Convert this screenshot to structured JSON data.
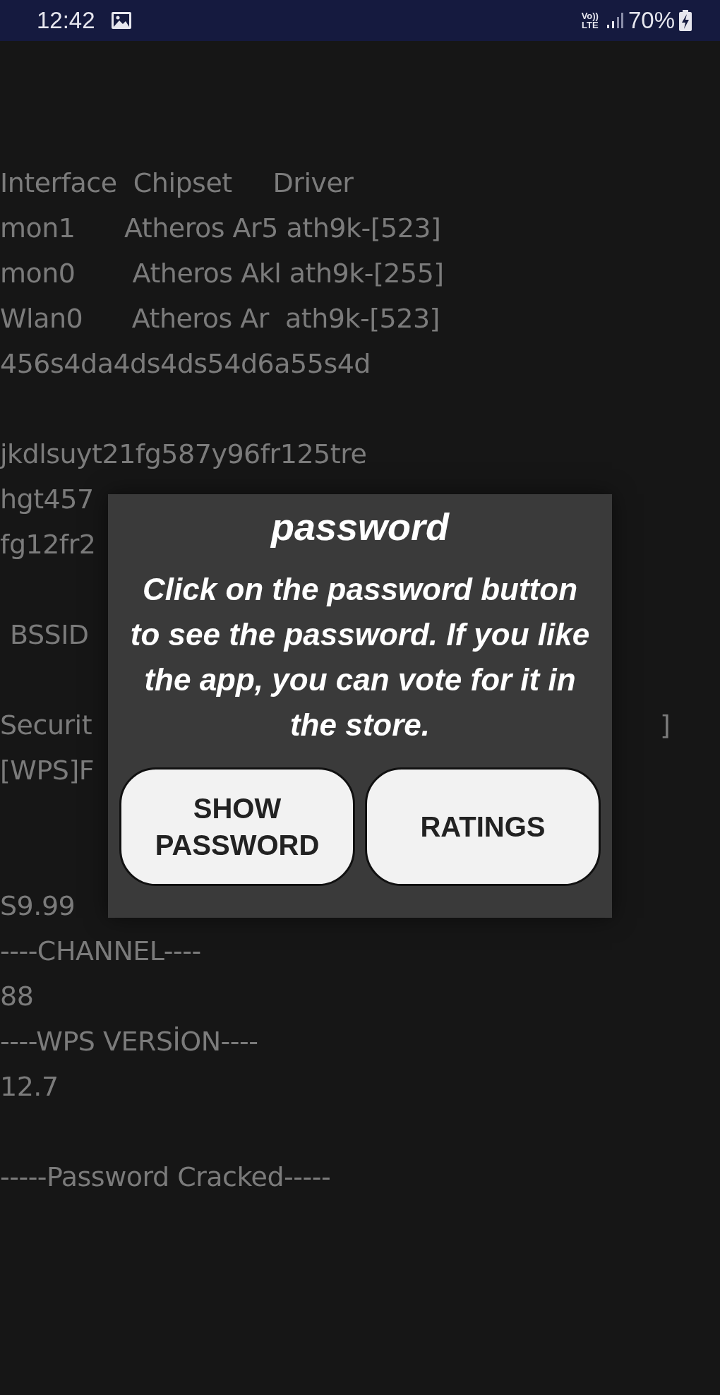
{
  "status_bar": {
    "time": "12:42",
    "network": "Vo))",
    "network_type": "LTE",
    "battery": "70%"
  },
  "console": [
    {
      "kind": "blank"
    },
    {
      "kind": "line",
      "text": "Interface  Chipset     Driver"
    },
    {
      "kind": "line",
      "text": "mon1      Atheros Ar5 ath9k-[523]"
    },
    {
      "kind": "line",
      "text": "mon0       Atheros Akl ath9k-[255]"
    },
    {
      "kind": "line",
      "text": "Wlan0      Atheros Ar  ath9k-[523]"
    },
    {
      "kind": "line",
      "text": "456s4da4ds4ds54d6a55s4d"
    },
    {
      "kind": "blank"
    },
    {
      "kind": "line",
      "text": "jkdlsuyt21fg587y96fr125tre"
    },
    {
      "kind": "line",
      "text": "hgt457"
    },
    {
      "kind": "line",
      "text": "fg12fr2"
    },
    {
      "kind": "blank"
    },
    {
      "kind": "indented",
      "text": "BSSID"
    },
    {
      "kind": "blank"
    },
    {
      "kind": "split",
      "text": "Securit",
      "tail": "]"
    },
    {
      "kind": "line",
      "text": "[WPS]F"
    },
    {
      "kind": "blank"
    },
    {
      "kind": "blank"
    },
    {
      "kind": "line",
      "text": "S9.99"
    },
    {
      "kind": "line",
      "text": "----CHANNEL----"
    },
    {
      "kind": "line",
      "text": "88"
    },
    {
      "kind": "line",
      "text": "----WPS VERSİON----"
    },
    {
      "kind": "line",
      "text": "12.7"
    },
    {
      "kind": "blank"
    },
    {
      "kind": "line",
      "text": "-----Password Cracked-----"
    }
  ],
  "dialog": {
    "title": "password",
    "message": "Click on the password button to see the password. If you like the app, you can vote for it in the store.",
    "buttons": [
      {
        "label": "SHOW PASSWORD"
      },
      {
        "label": "RATINGS"
      }
    ]
  }
}
